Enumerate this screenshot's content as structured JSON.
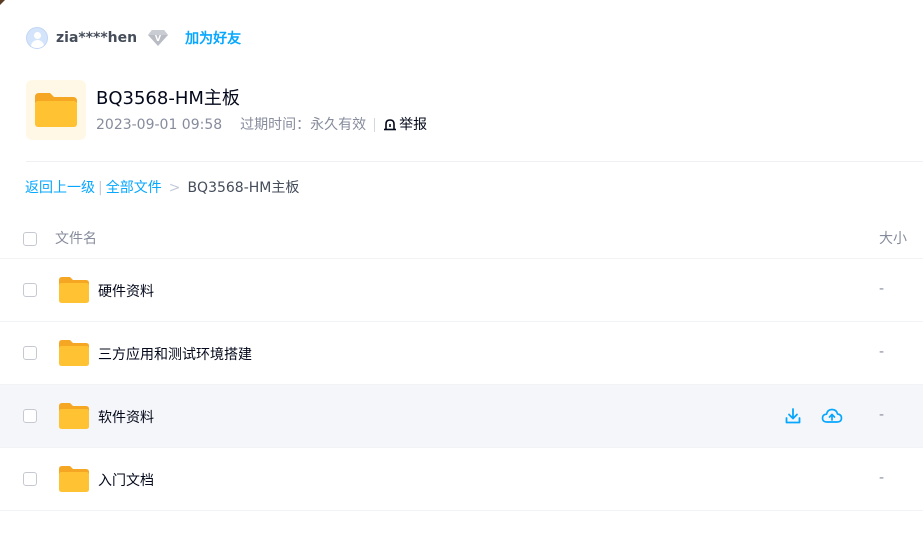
{
  "user": {
    "name": "zia****hen",
    "vip_badge": "V",
    "add_friend_label": "加为好友"
  },
  "share": {
    "title": "BQ3568-HM主板",
    "date": "2023-09-01 09:58",
    "expire_label": "过期时间：永久有效",
    "report_label": "举报"
  },
  "breadcrumb": {
    "back_label": "返回上一级",
    "divider": "|",
    "all_files_label": "全部文件",
    "arrow": ">",
    "current": "BQ3568-HM主板"
  },
  "list": {
    "header": {
      "name_label": "文件名",
      "size_label": "大小"
    },
    "rows": [
      {
        "name": "硬件资料",
        "size": "-"
      },
      {
        "name": "三方应用和测试环境搭建",
        "size": "-"
      },
      {
        "name": "软件资料",
        "size": "-"
      },
      {
        "name": "入门文档",
        "size": "-"
      }
    ]
  },
  "colors": {
    "accent": "#06a7ff",
    "folder": "#ffc233",
    "hover_row": "#f5f6f9"
  },
  "icons": {
    "avatar": "avatar-icon",
    "vip": "vip-diamond-icon",
    "folder": "folder-icon",
    "report": "report-alarm-icon",
    "download": "download-icon",
    "save_cloud": "cloud-upload-icon"
  }
}
